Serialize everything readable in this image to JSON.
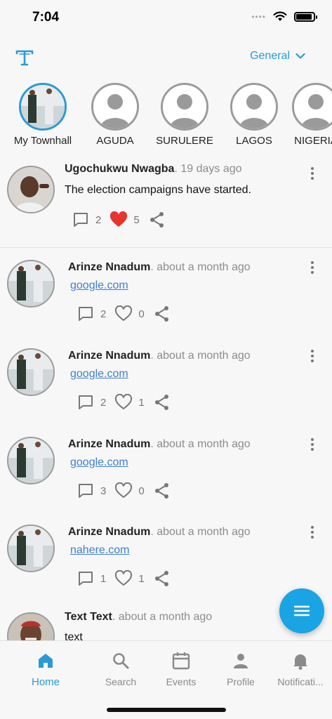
{
  "status_bar": {
    "time": "7:04"
  },
  "header": {
    "channel": "General"
  },
  "stories": [
    {
      "label": "My Townhall",
      "active": true
    },
    {
      "label": "AGUDA",
      "active": false
    },
    {
      "label": "SURULERE",
      "active": false
    },
    {
      "label": "LAGOS",
      "active": false
    },
    {
      "label": "NIGERIA",
      "active": false
    }
  ],
  "posts": [
    {
      "author": "Ugochukwu Nwagba",
      "meta": ". 19 days ago",
      "text": "The election campaigns have started.",
      "link": "",
      "comments": "2",
      "likes": "5",
      "liked": true
    },
    {
      "author": "Arinze Nnadum",
      "meta": ". about a month ago",
      "text": "",
      "link": "google.com",
      "comments": "2",
      "likes": "0",
      "liked": false
    },
    {
      "author": "Arinze Nnadum",
      "meta": ". about a month ago",
      "text": "",
      "link": "google.com",
      "comments": "2",
      "likes": "1",
      "liked": false
    },
    {
      "author": "Arinze Nnadum",
      "meta": ". about a month ago",
      "text": "",
      "link": "google.com",
      "comments": "3",
      "likes": "0",
      "liked": false
    },
    {
      "author": "Arinze Nnadum",
      "meta": ". about a month ago",
      "text": "",
      "link": "nahere.com",
      "comments": "1",
      "likes": "1",
      "liked": false
    },
    {
      "author": "Text Text",
      "meta": ". about a month ago",
      "text": "text",
      "link": "",
      "comments": "",
      "likes": "",
      "liked": false
    }
  ],
  "bottom_nav": [
    {
      "label": "Home",
      "icon": "home-icon",
      "active": true
    },
    {
      "label": "Search",
      "icon": "search-icon",
      "active": false
    },
    {
      "label": "Events",
      "icon": "calendar-icon",
      "active": false
    },
    {
      "label": "Profile",
      "icon": "person-icon",
      "active": false
    },
    {
      "label": "Notificati...",
      "icon": "bell-icon",
      "active": false
    }
  ],
  "colors": {
    "accent": "#2a9ad6",
    "fab": "#1aa4e4",
    "like": "#e8332e",
    "link": "#3f7fcf"
  }
}
